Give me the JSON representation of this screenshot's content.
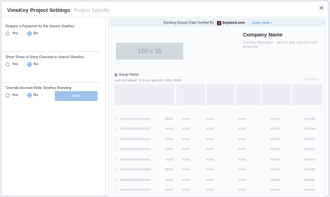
{
  "modal": {
    "title": "ViewKey Project Settings",
    "subtitle": "Project Specific",
    "close_icon": "close-icon"
  },
  "settings": [
    {
      "label": "Require a Password for the shared ViewKey",
      "options": [
        "Yes",
        "No"
      ],
      "selected": "No"
    },
    {
      "label": "Show Share of Voice Overview in shared ViewKey",
      "options": [
        "Yes",
        "No"
      ],
      "selected": "No"
    },
    {
      "label": "Override Account-Wide ViewKey Branding",
      "options": [
        "Yes",
        "No"
      ],
      "selected": "No"
    }
  ],
  "save_label": "Save",
  "preview": {
    "verify_text": "Ranking Report Data Verified By",
    "brand": "keyword.com",
    "learn_more": "Learn more ›",
    "logo_placeholder": "150 x 35",
    "company_name": "Company Name",
    "company_desc": "Company description - say hi to your customers and prospects!",
    "group_name": "Group Name",
    "last_refreshed": "Last Refreshed: 11 hours ago (Nov 28th, 2018)"
  },
  "colors": {
    "accent": "#3c7ed8",
    "save_button": "#9cc1ea",
    "brand_mark": "#e8533c"
  }
}
